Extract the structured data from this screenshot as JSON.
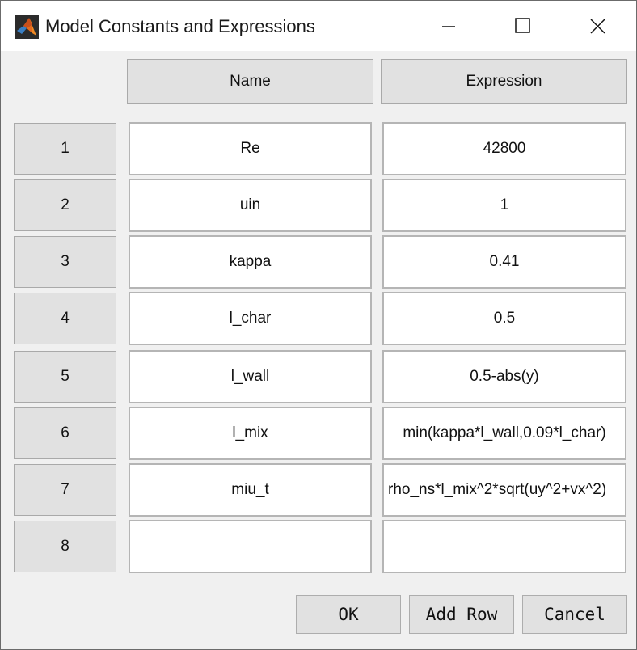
{
  "window": {
    "title": "Model Constants and Expressions"
  },
  "icons": {
    "app": "matlab-logo-icon",
    "minimize": "minimize-icon",
    "maximize": "maximize-icon",
    "close": "close-icon"
  },
  "table": {
    "headers": {
      "name": "Name",
      "expression": "Expression"
    },
    "rows": [
      {
        "num": "1",
        "name": "Re",
        "expr": "42800"
      },
      {
        "num": "2",
        "name": "uin",
        "expr": "1"
      },
      {
        "num": "3",
        "name": "kappa",
        "expr": "0.41"
      },
      {
        "num": "4",
        "name": "l_char",
        "expr": "0.5"
      },
      {
        "num": "5",
        "name": "l_wall",
        "expr": "0.5-abs(y)"
      },
      {
        "num": "6",
        "name": "l_mix",
        "expr": "min(kappa*l_wall,0.09*l_char)"
      },
      {
        "num": "7",
        "name": "miu_t",
        "expr": "rho_ns*l_mix^2*sqrt(uy^2+vx^2)"
      },
      {
        "num": "8",
        "name": "",
        "expr": ""
      }
    ]
  },
  "buttons": {
    "ok": "OK",
    "add_row": "Add Row",
    "cancel": "Cancel"
  }
}
